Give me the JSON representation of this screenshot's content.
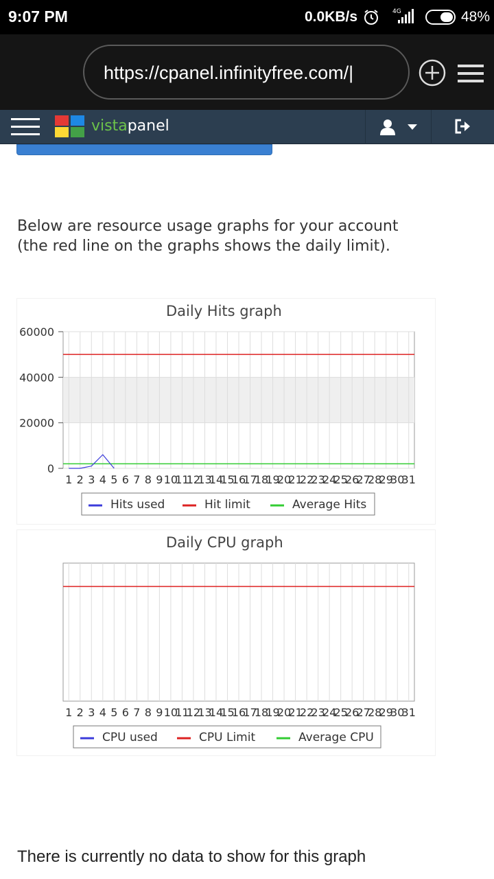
{
  "status_bar": {
    "time": "9:07 PM",
    "network_speed": "0.0KB/s",
    "network_type": "4G",
    "battery": "48%",
    "icons": [
      "alarm-icon",
      "signal-icon",
      "battery-icon"
    ]
  },
  "browser": {
    "url": "https://cpanel.infinityfree.com/|",
    "new_tab_icon": "plus-circle-icon",
    "menu_icon": "hamburger-icon"
  },
  "vistapanel": {
    "brand_vista": "vista",
    "brand_panel": "panel",
    "menu_icon": "hamburger-icon",
    "user_icon": "user-icon",
    "caret_icon": "caret-down-icon",
    "logout_icon": "logout-icon",
    "colors": {
      "navbar": "#2c3e50",
      "vista": "#6cc24a",
      "button": "#3a80d2"
    }
  },
  "intro_text": "Below are resource usage graphs for your account (the red line on the graphs shows the daily limit).",
  "nodata_text": "There is currently no data to show for this graph",
  "chart_data": [
    {
      "type": "line",
      "title": "Daily Hits graph",
      "x": [
        "1",
        "2",
        "3",
        "4",
        "5",
        "6",
        "7",
        "8",
        "9",
        "10",
        "11",
        "12",
        "13",
        "14",
        "15",
        "16",
        "17",
        "18",
        "19",
        "20",
        "21",
        "22",
        "23",
        "24",
        "25",
        "26",
        "27",
        "28",
        "29",
        "30",
        "31"
      ],
      "y_ticks": [
        "0",
        "20000",
        "40000",
        "60000"
      ],
      "y_tick_labels_visible": [
        "0",
        "20000",
        "40000",
        "60000"
      ],
      "ylim": [
        0,
        60000
      ],
      "grid": true,
      "series": [
        {
          "name": "Hits used",
          "color": "#3b3bdb",
          "values": [
            0,
            0,
            1000,
            6000,
            0,
            null,
            null,
            null,
            null,
            null,
            null,
            null,
            null,
            null,
            null,
            null,
            null,
            null,
            null,
            null,
            null,
            null,
            null,
            null,
            null,
            null,
            null,
            null,
            null,
            null,
            null
          ]
        },
        {
          "name": "Hit limit",
          "color": "#dd2222",
          "constant": 50000
        },
        {
          "name": "Average Hits",
          "color": "#33cc33",
          "constant": 2000
        }
      ],
      "legend": [
        "Hits used",
        "Hit limit",
        "Average Hits"
      ],
      "legend_position": "bottom"
    },
    {
      "type": "line",
      "title": "Daily CPU graph",
      "x": [
        "1",
        "2",
        "3",
        "4",
        "5",
        "6",
        "7",
        "8",
        "9",
        "10",
        "11",
        "12",
        "13",
        "14",
        "15",
        "16",
        "17",
        "18",
        "19",
        "20",
        "21",
        "22",
        "23",
        "24",
        "25",
        "26",
        "27",
        "28",
        "29",
        "30",
        "31"
      ],
      "grid": true,
      "series": [
        {
          "name": "CPU used",
          "color": "#3b3bdb",
          "values": []
        },
        {
          "name": "CPU Limit",
          "color": "#dd2222",
          "constant": 1
        },
        {
          "name": "Average CPU",
          "color": "#33cc33",
          "values": []
        }
      ],
      "legend": [
        "CPU used",
        "CPU Limit",
        "Average CPU"
      ],
      "legend_position": "bottom"
    }
  ]
}
